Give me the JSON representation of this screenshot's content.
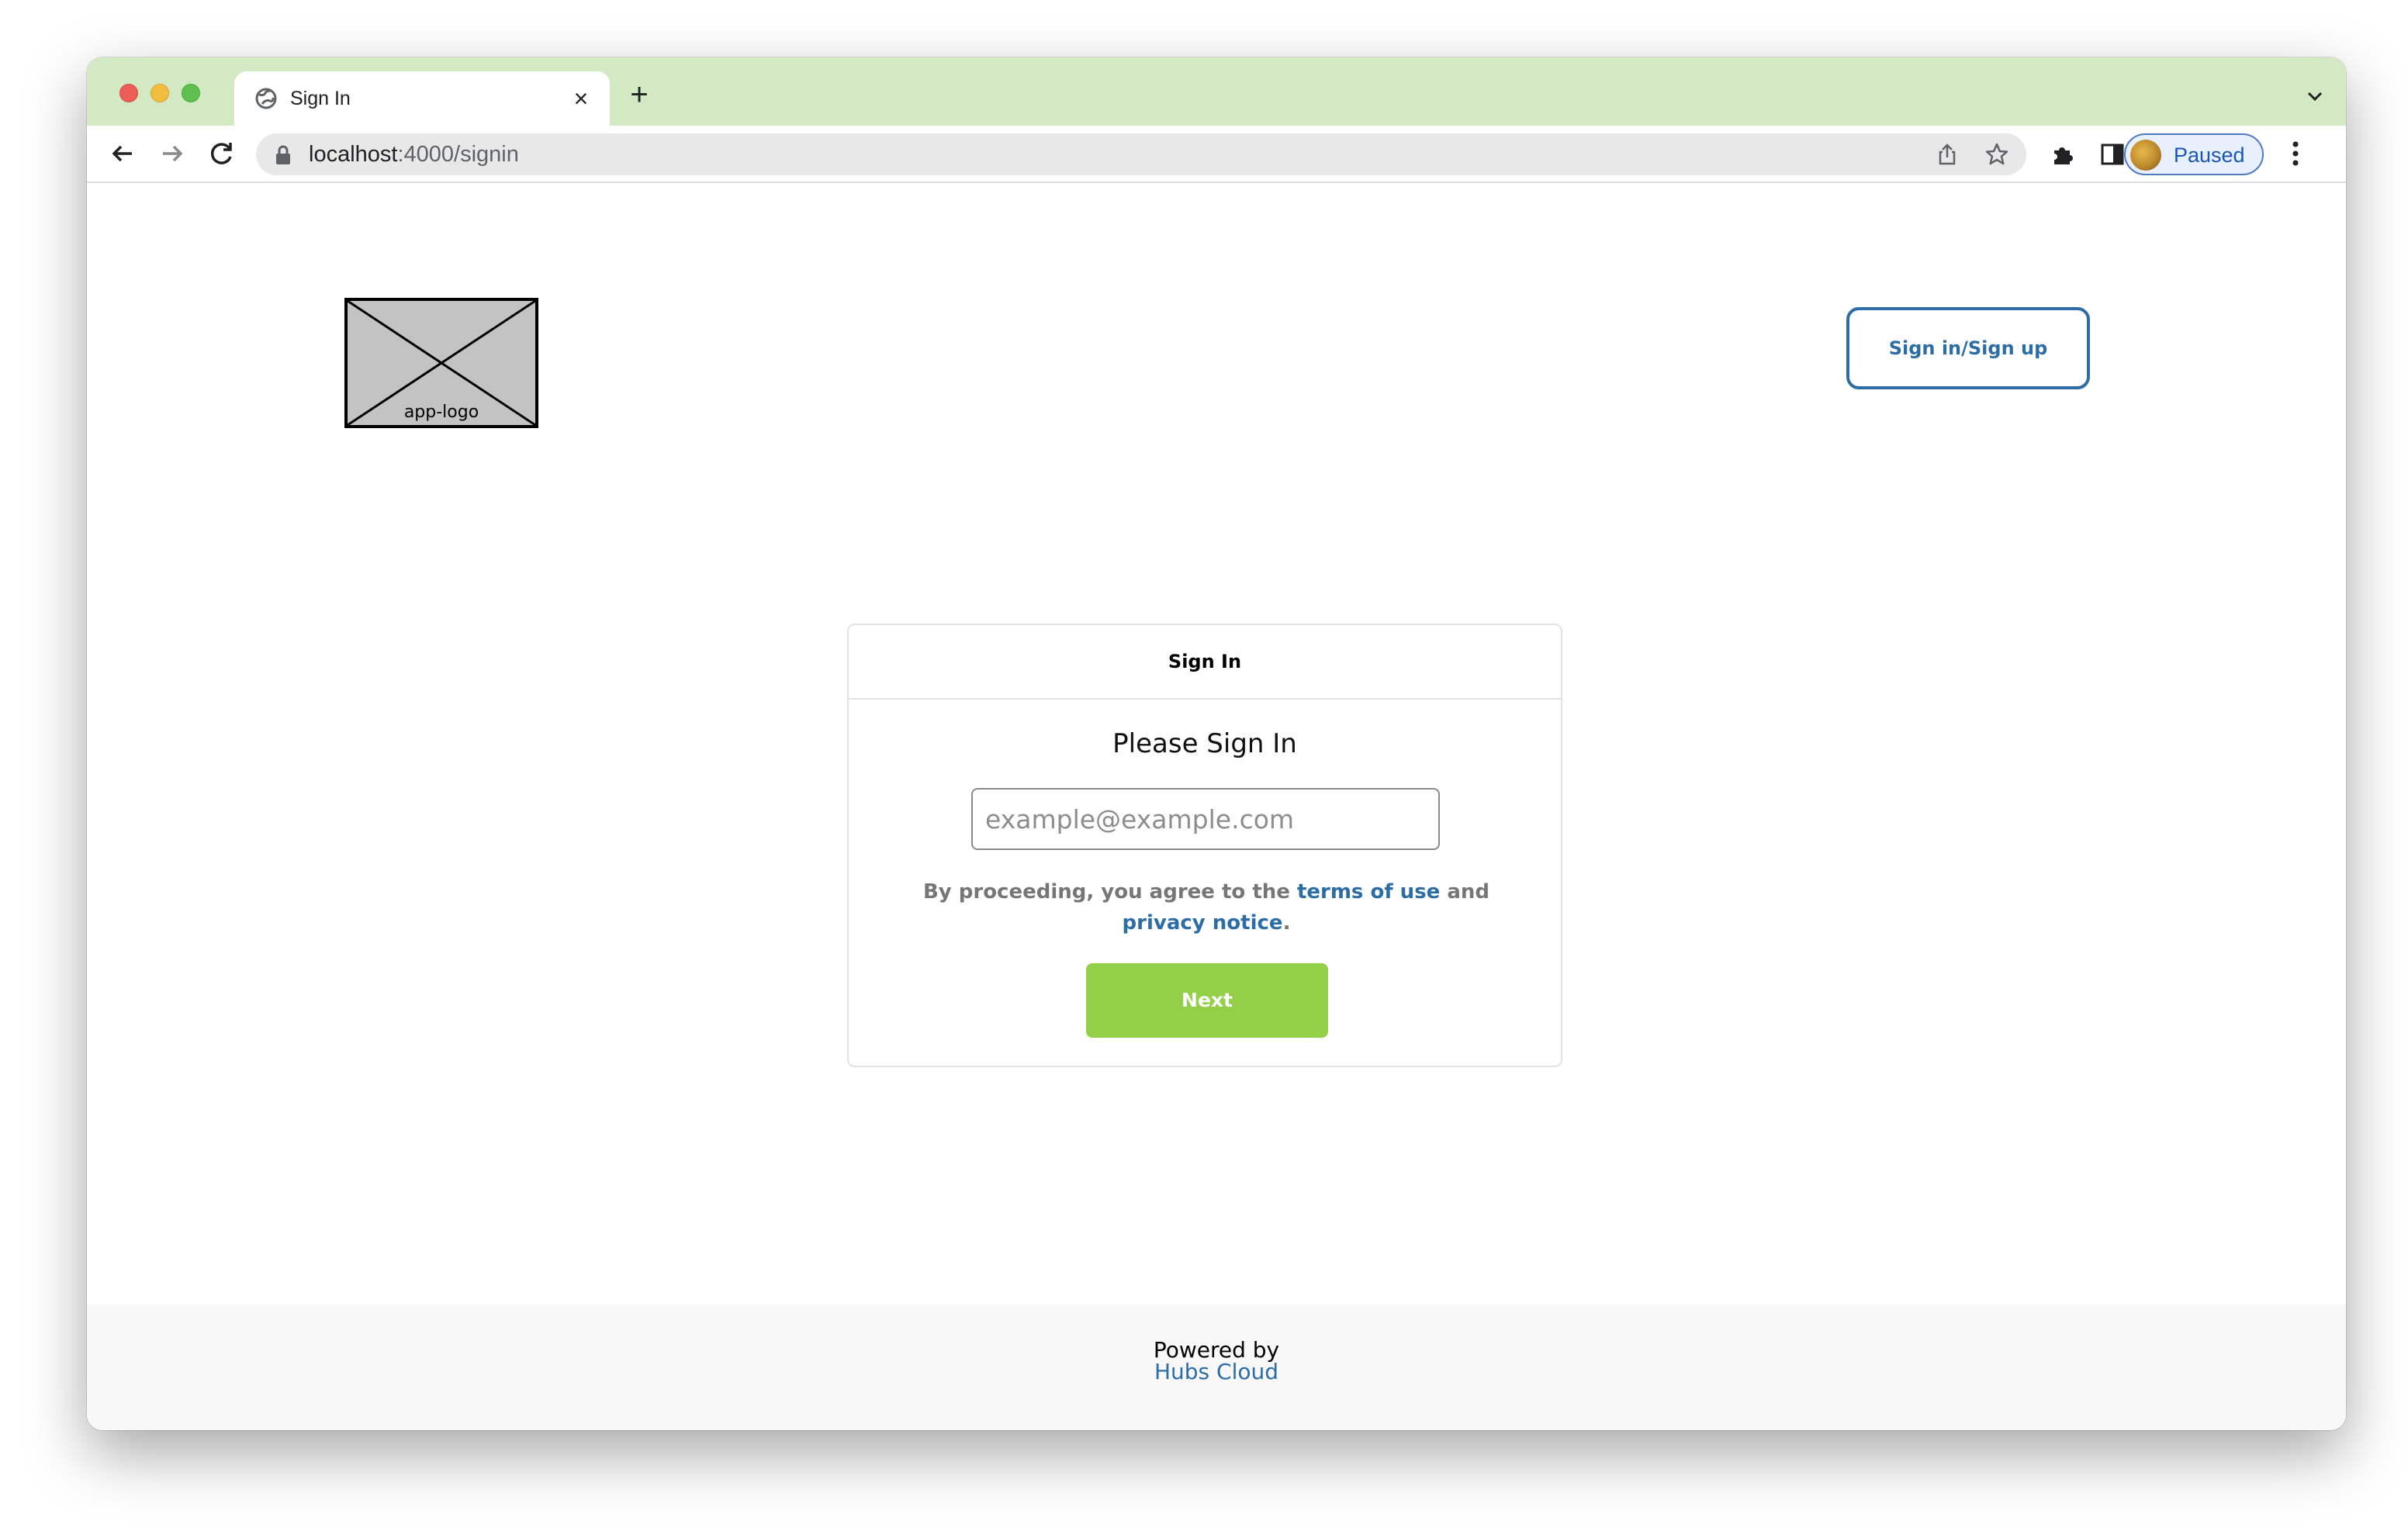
{
  "browser": {
    "tab": {
      "title": "Sign In",
      "icon": "globe-icon"
    },
    "address_bar": {
      "host": "localhost",
      "path": ":4000/signin"
    },
    "profile": {
      "label": "Paused"
    }
  },
  "header": {
    "logo_label": "app-logo",
    "auth_button_label": "Sign in/Sign up"
  },
  "signin_card": {
    "header_title": "Sign In",
    "title": "Please Sign In",
    "email_placeholder": "example@example.com",
    "agreement": {
      "prefix": "By proceeding, you agree to the",
      "terms_link": "terms of use",
      "joiner": "and",
      "privacy_link": "privacy notice",
      "suffix": "."
    },
    "next_label": "Next"
  },
  "footer": {
    "powered_by": "Powered by",
    "brand": "Hubs Cloud"
  },
  "colors": {
    "tab_strip": "#d3e9c3",
    "accent_blue": "#2c6da7",
    "next_green": "#93cf47"
  }
}
